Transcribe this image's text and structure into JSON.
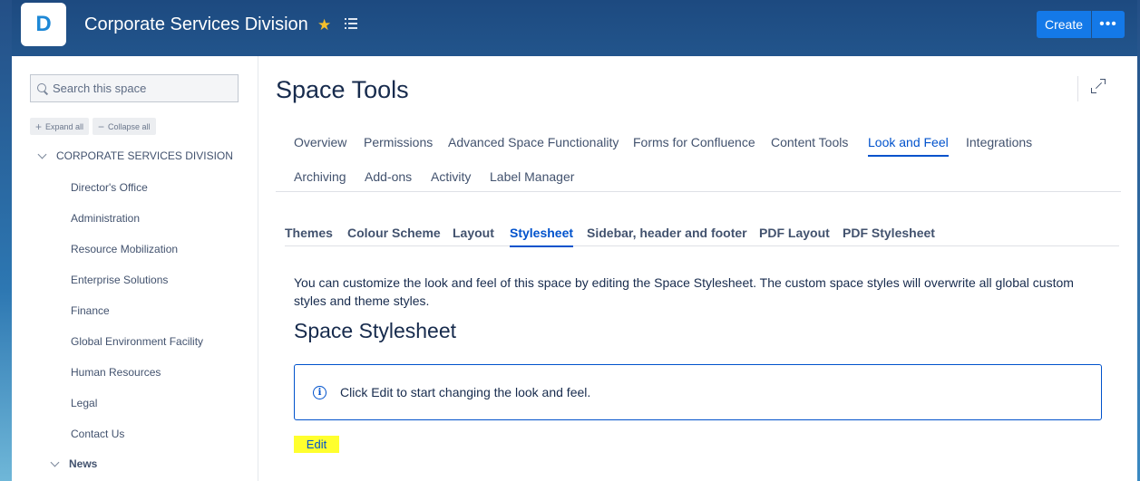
{
  "header": {
    "logo_letter": "D",
    "space_name": "Corporate Services Division",
    "create_label": "Create",
    "more_label": "•••"
  },
  "sidebar": {
    "search_placeholder": "Search this space",
    "expand_all": "Expand all",
    "collapse_all": "Collapse all",
    "root_label": "CORPORATE SERVICES DIVISION",
    "items": [
      "Director's Office",
      "Administration",
      "Resource Mobilization",
      "Enterprise Solutions",
      "Finance",
      "Global Environment Facility",
      "Human Resources",
      "Legal",
      "Contact Us"
    ],
    "news_label": "News"
  },
  "main": {
    "page_title": "Space Tools",
    "tabs": [
      {
        "label": "Overview"
      },
      {
        "label": "Permissions"
      },
      {
        "label": "Advanced Space Functionality"
      },
      {
        "label": "Forms for Confluence"
      },
      {
        "label": "Content Tools"
      },
      {
        "label": "Look and Feel",
        "active": true
      },
      {
        "label": "Integrations"
      },
      {
        "label": "Archiving"
      },
      {
        "label": "Add-ons"
      },
      {
        "label": "Activity"
      },
      {
        "label": "Label Manager"
      }
    ],
    "subtabs": [
      {
        "label": "Themes"
      },
      {
        "label": "Colour Scheme"
      },
      {
        "label": "Layout"
      },
      {
        "label": "Stylesheet",
        "active": true
      },
      {
        "label": "Sidebar, header and footer"
      },
      {
        "label": "PDF Layout"
      },
      {
        "label": "PDF Stylesheet"
      }
    ],
    "description": "You can customize the look and feel of this space by editing the Space Stylesheet. The custom space styles will overwrite all global custom styles and theme styles.",
    "section_title": "Space Stylesheet",
    "info_message": "Click Edit to start changing the look and feel.",
    "edit_label": "Edit"
  },
  "colors": {
    "accent": "#0052cc",
    "create_button": "#1479e8",
    "edit_highlight": "#ffff2e",
    "star": "#f5c02c"
  }
}
